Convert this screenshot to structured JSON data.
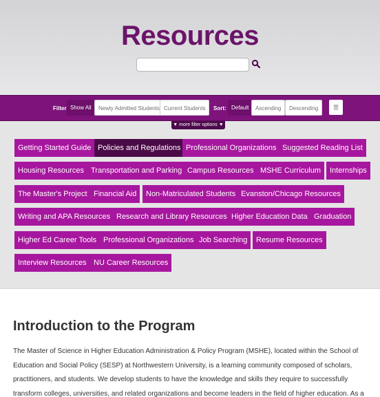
{
  "header": {
    "title": "Resources"
  },
  "search": {
    "placeholder": ""
  },
  "filter": {
    "label": "Filter:",
    "options": [
      "Show All",
      "Newly Admitted Students",
      "Current Students"
    ],
    "active": "Show All"
  },
  "sort": {
    "label": "Sort:",
    "options": [
      "Default",
      "Ascending",
      "Descending"
    ],
    "active": "Default"
  },
  "menu": {
    "icon": "hamburger-icon",
    "glyph": "☰"
  },
  "more_filters": {
    "label": "▼ more filter options ▼"
  },
  "tags": [
    {
      "label": "Getting Started Guide",
      "active": false
    },
    {
      "label": "Policies and Regulations",
      "active": true
    },
    {
      "label": "Professional Organizations",
      "active": false
    },
    {
      "label": "Suggested Reading List",
      "active": false
    },
    {
      "label": "Housing Resources",
      "active": false
    },
    {
      "label": "Transportation and Parking",
      "active": false
    },
    {
      "label": "Campus Resources",
      "active": false
    },
    {
      "label": "MSHE Curriculum",
      "active": false
    },
    {
      "label": "Internships",
      "active": false
    },
    {
      "label": "The Master's Project",
      "active": false
    },
    {
      "label": "Financial Aid",
      "active": false
    },
    {
      "label": "Non-Matriculated Students",
      "active": false
    },
    {
      "label": "Evanston/Chicago Resources",
      "active": false
    },
    {
      "label": "Writing and APA Resources",
      "active": false
    },
    {
      "label": "Research and Library Resources",
      "active": false
    },
    {
      "label": "Higher Education Data",
      "active": false
    },
    {
      "label": "Graduation",
      "active": false
    },
    {
      "label": "Higher Ed Career Tools",
      "active": false
    },
    {
      "label": "Professional Organizations",
      "active": false
    },
    {
      "label": "Job Searching",
      "active": false
    },
    {
      "label": "Resume Resources",
      "active": false
    },
    {
      "label": "Interview Resources",
      "active": false
    },
    {
      "label": "NU Career Resources",
      "active": false
    }
  ],
  "intro": {
    "heading": "Introduction to the Program",
    "body": "The Master of Science in Higher Education Administration & Policy Program (MSHE), located within the School of Education and Social Policy (SESP) at Northwestern University, is a learning community composed of scholars, practitioners, and students. We develop students to have the knowledge and skills they require to successfully transform colleges, universities, and related organizations and become leaders in the field of higher education. As a learning community we value collaboration, honesty and"
  },
  "colors": {
    "brand": "#7e137c",
    "tag": "#a7169e",
    "tag_active": "#4a0a47",
    "title": "#6b1469"
  }
}
